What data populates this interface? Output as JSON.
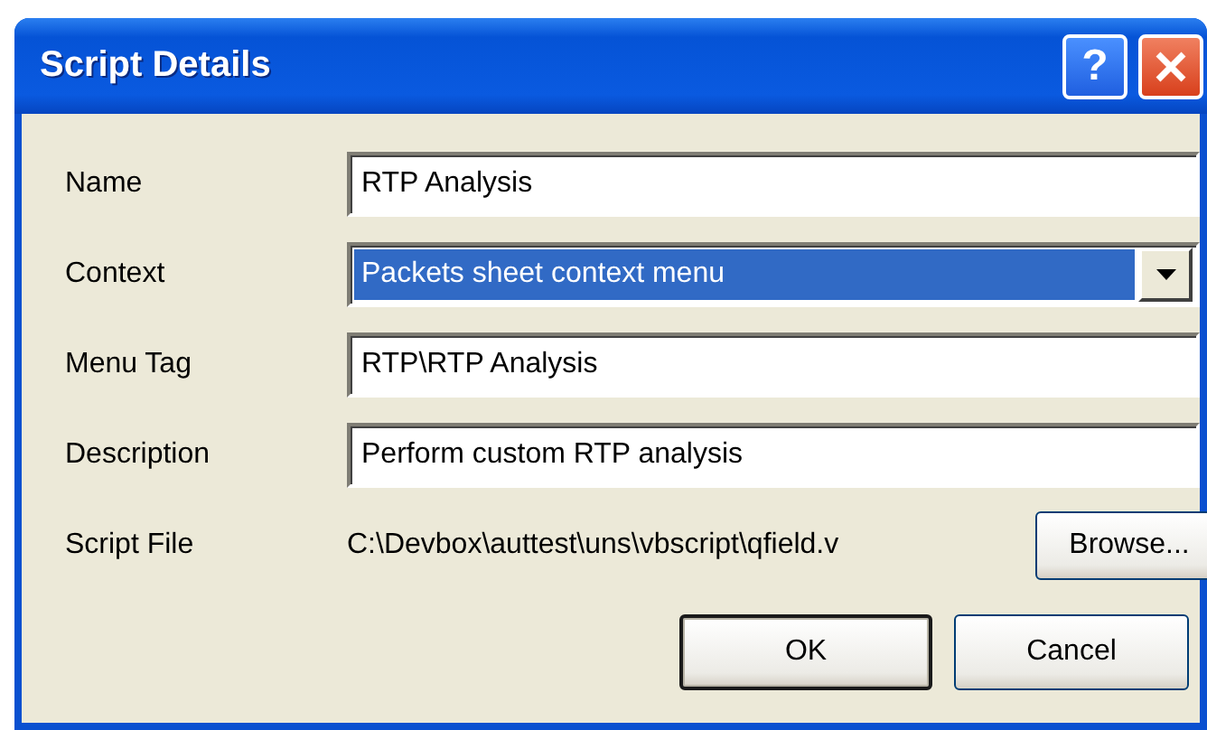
{
  "window": {
    "title": "Script Details",
    "title_buttons": [
      {
        "kind": "help",
        "label": "?"
      },
      {
        "kind": "close"
      }
    ]
  },
  "fields": [
    {
      "label": "Name",
      "kind": "text",
      "value": "RTP Analysis"
    },
    {
      "label": "Context",
      "kind": "dropdown",
      "value": "Packets sheet context menu",
      "selected": true
    },
    {
      "label": "Menu Tag",
      "kind": "text",
      "value": "RTP\\RTP Analysis"
    },
    {
      "label": "Description",
      "kind": "text",
      "value": "Perform custom RTP analysis"
    },
    {
      "label": "Script File",
      "kind": "file",
      "value": "C:\\Devbox\\auttest\\uns\\vbscript\\qfield.v",
      "button": "Browse..."
    }
  ],
  "buttons": [
    {
      "label": "OK",
      "default": true
    },
    {
      "label": "Cancel",
      "default": false
    }
  ]
}
